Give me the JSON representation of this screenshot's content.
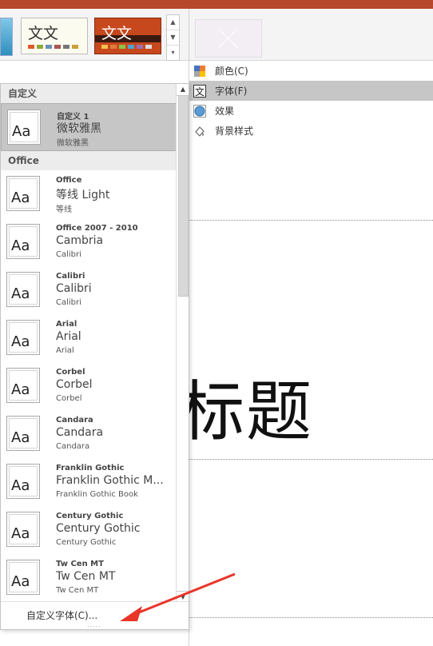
{
  "ribbon": {
    "theme_thumbs": [
      {
        "label": "文文"
      },
      {
        "label": "文文"
      }
    ],
    "variant_menu": [
      {
        "label": "颜色(C)",
        "icon": "color-palette-icon"
      },
      {
        "label": "字体(F)",
        "icon": "font-text-icon",
        "active": true
      },
      {
        "label": "效果",
        "icon": "effects-circle-icon"
      },
      {
        "label": "背景样式",
        "icon": "background-fill-icon"
      }
    ]
  },
  "slide": {
    "title_text": "标题"
  },
  "font_panel": {
    "section_custom": "自定义",
    "section_office": "Office",
    "custom_items": [
      {
        "name": "自定义 1",
        "heading": "微软雅黑",
        "body": "微软雅黑",
        "selected": true
      }
    ],
    "office_items": [
      {
        "name": "Office",
        "heading": "等线 Light",
        "body": "等线"
      },
      {
        "name": "Office 2007 - 2010",
        "heading": "Cambria",
        "body": "Calibri"
      },
      {
        "name": "Calibri",
        "heading": "Calibri",
        "body": "Calibri"
      },
      {
        "name": "Arial",
        "heading": "Arial",
        "body": "Arial"
      },
      {
        "name": "Corbel",
        "heading": "Corbel",
        "body": "Corbel"
      },
      {
        "name": "Candara",
        "heading": "Candara",
        "body": "Candara"
      },
      {
        "name": "Franklin Gothic",
        "heading": "Franklin Gothic M...",
        "body": "Franklin Gothic Book"
      },
      {
        "name": "Century Gothic",
        "heading": "Century Gothic",
        "body": "Century Gothic"
      },
      {
        "name": "Tw Cen MT",
        "heading": "Tw Cen MT",
        "body": "Tw Cen MT"
      }
    ],
    "thumb_glyph": "Aa",
    "footer_link": "自定义字体(C)...",
    "grip": "....."
  },
  "colors": {
    "accent_bar": "#b7472a",
    "selection": "#c6c6c6",
    "annotation_arrow": "#e8352a"
  }
}
